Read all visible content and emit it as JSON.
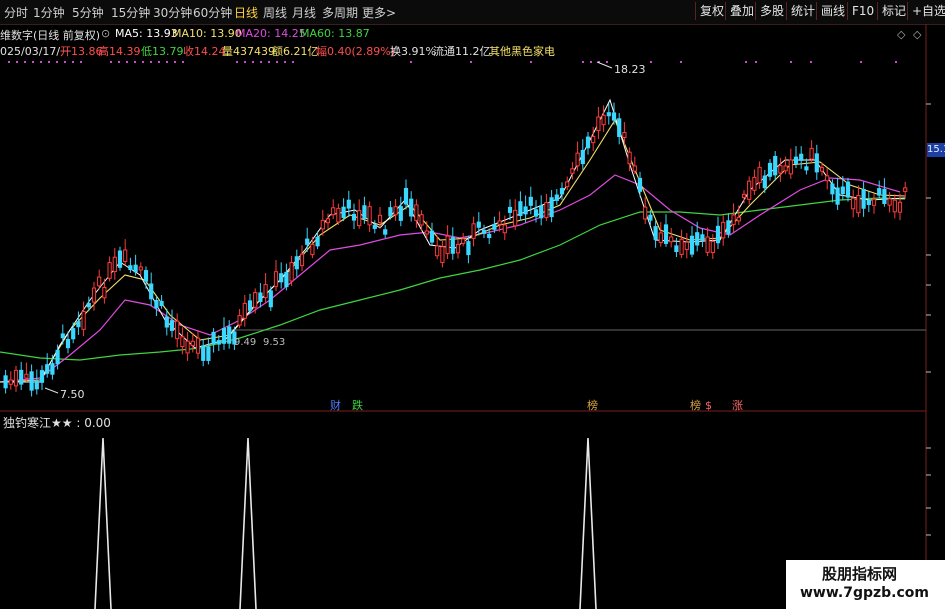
{
  "toolbar": {
    "periods": [
      "分时",
      "1分钟",
      "5分钟",
      "15分钟",
      "30分钟",
      "60分钟",
      "日线",
      "周线",
      "月线",
      "多周期",
      "更多>"
    ],
    "active_period": "日线",
    "buttons": [
      "复权",
      "叠加",
      "多股",
      "统计",
      "画线",
      "F10",
      "标记",
      "+自选"
    ]
  },
  "info": {
    "title": "维数字(日线 前复权)",
    "ma5": "MA5: 13.93",
    "ma10": "MA10: 13.90",
    "ma20": "MA20: 14.25",
    "ma60": "MA60: 13.87",
    "date": "025/03/17/一",
    "open": "开13.86",
    "high": "高14.39",
    "low": "低13.79",
    "close": "收14.24",
    "volume": "量437439",
    "amount": "额6.21亿",
    "change": "幅0.40(2.89%)",
    "turnover": "换3.91%",
    "float": "流通11.2亿",
    "sector": "其他黑色家电"
  },
  "annotations": {
    "high_label": "18.23",
    "low_label": "7.50",
    "mid_label_1": "9.49",
    "mid_label_2": "9.53"
  },
  "markers": [
    "财",
    "跌",
    "榜",
    "榜",
    "$",
    "涨"
  ],
  "axis_badge": "15.1",
  "indicator": {
    "name": "独钓寒江★★",
    "value": ": 0.00"
  },
  "watermark": {
    "line1": "股朋指标网",
    "line2": "www.7gpzb.com"
  },
  "colors": {
    "up": "#ff3b3b",
    "down": "#3ad7ff",
    "ma5": "#ffffff",
    "ma10": "#f3e06b",
    "ma20": "#e04ce0",
    "ma60": "#3fd43f",
    "accent": "#ffd23f"
  }
}
